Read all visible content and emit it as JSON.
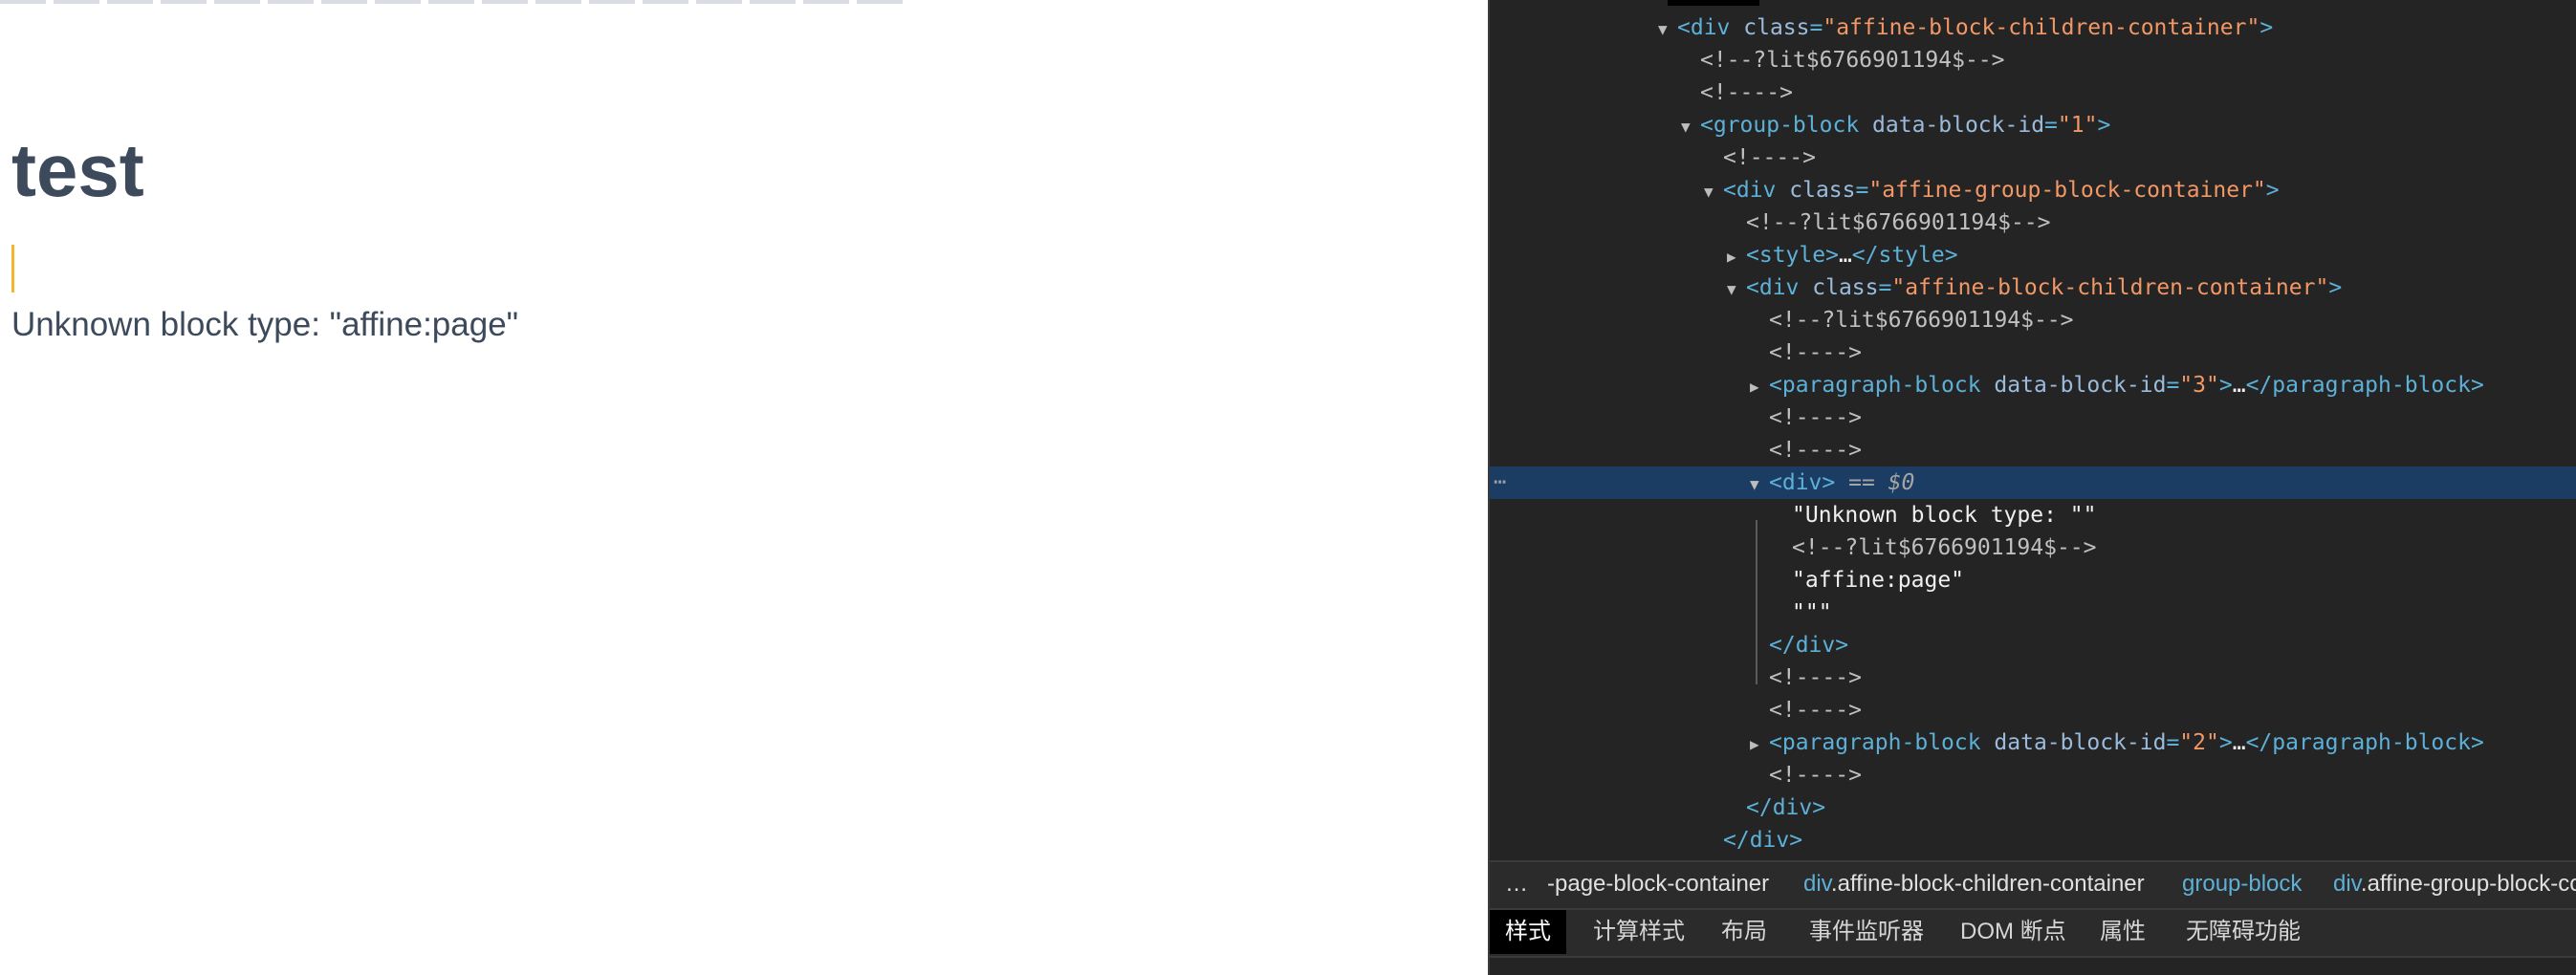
{
  "page": {
    "title": "test",
    "unknown_block_text": "Unknown block type: \"affine:page\"",
    "colors": {
      "title": "#3d4a5c",
      "caret": "#f5b52f"
    }
  },
  "devtools": {
    "selected_marker": "== $0",
    "row_dots": "⋯",
    "tree": [
      {
        "tag_open": "<div",
        "attr": "class",
        "val": "\"affine-block-children-container\"",
        "close": ">"
      },
      {
        "comment": "<!--?lit$6766901194$-->"
      },
      {
        "comment": "<!---->"
      },
      {
        "tag_open": "<group-block",
        "attr": "data-block-id",
        "val": "\"1\"",
        "close": ">"
      },
      {
        "comment": "<!---->"
      },
      {
        "tag_open": "<div",
        "attr": "class",
        "val": "\"affine-group-block-container\"",
        "close": ">"
      },
      {
        "comment": "<!--?lit$6766901194$-->"
      },
      {
        "tag_open": "<style>",
        "ellipsis": "…",
        "tag_close": "</style>"
      },
      {
        "tag_open": "<div",
        "attr": "class",
        "val": "\"affine-block-children-container\"",
        "close": ">"
      },
      {
        "comment": "<!--?lit$6766901194$-->"
      },
      {
        "comment": "<!---->"
      },
      {
        "tag_open": "<paragraph-block",
        "attr": "data-block-id",
        "val": "\"3\"",
        "close": ">",
        "ellipsis": "…",
        "tag_close": "</paragraph-block>"
      },
      {
        "comment": "<!---->"
      },
      {
        "comment": "<!---->"
      },
      {
        "tag_open": "<div>"
      },
      {
        "text": "\"Unknown block type: \"\""
      },
      {
        "comment": "<!--?lit$6766901194$-->"
      },
      {
        "text": "\"affine:page\""
      },
      {
        "text": "\"\"\""
      },
      {
        "tag_close": "</div>"
      },
      {
        "comment": "<!---->"
      },
      {
        "comment": "<!---->"
      },
      {
        "tag_open": "<paragraph-block",
        "attr": "data-block-id",
        "val": "\"2\"",
        "close": ">",
        "ellipsis": "…",
        "tag_close": "</paragraph-block>"
      },
      {
        "comment": "<!---->"
      },
      {
        "tag_close": "</div>"
      },
      {
        "tag_close": "</div>"
      }
    ],
    "breadcrumbs": {
      "more": "…",
      "items": [
        {
          "prefix": "",
          "name": "-page-block-container"
        },
        {
          "prefix": "div",
          "name": ".affine-block-children-container"
        },
        {
          "prefix": "group-block",
          "name": ""
        },
        {
          "prefix": "div",
          "name": ".affine-group-block-container"
        }
      ]
    },
    "tabs": [
      "样式",
      "计算样式",
      "布局",
      "事件监听器",
      "DOM 断点",
      "属性",
      "无障碍功能"
    ]
  }
}
